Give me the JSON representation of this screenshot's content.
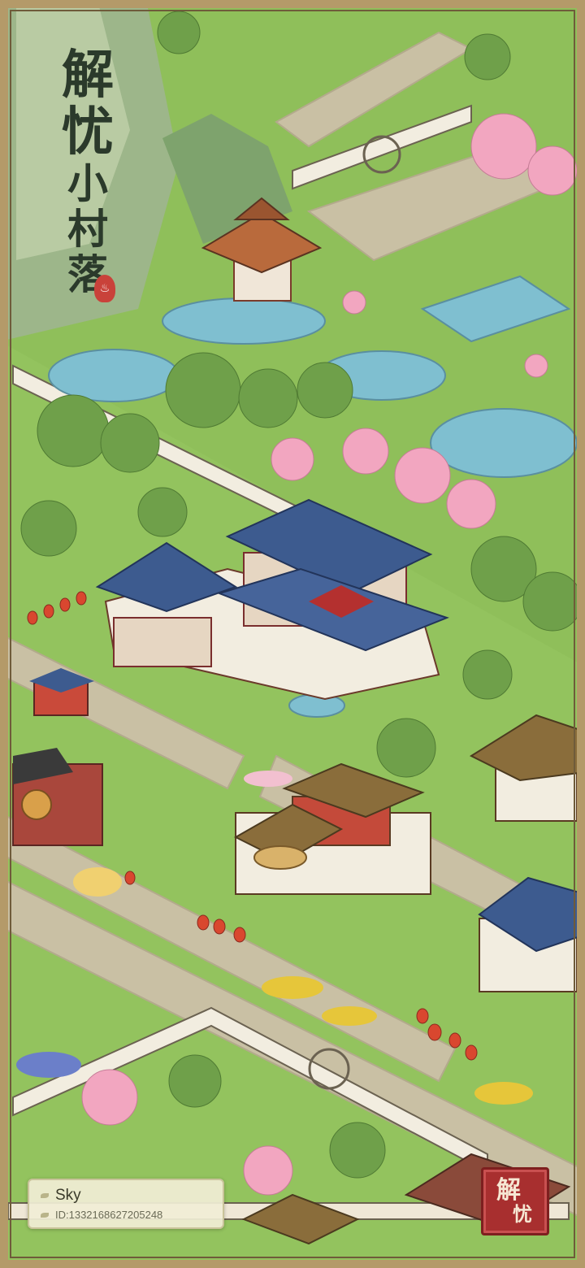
{
  "game": {
    "title_chars": [
      "解",
      "忧",
      "小",
      "村",
      "落"
    ],
    "seal_mark": "♨"
  },
  "player": {
    "name": "Sky",
    "id_text": "ID:1332168627205248"
  },
  "corner_seal": {
    "chars": [
      "解",
      "忧"
    ]
  },
  "palette": {
    "grass": "#8fbf5a",
    "path": "#c9c0a4",
    "wall": "#f2ede0",
    "roof_blue": "#3d5b8f",
    "roof_brown": "#8a6d3b",
    "water": "#7fbfd0",
    "blossom": "#f2a6c0",
    "seal_red": "#a82f2f"
  }
}
